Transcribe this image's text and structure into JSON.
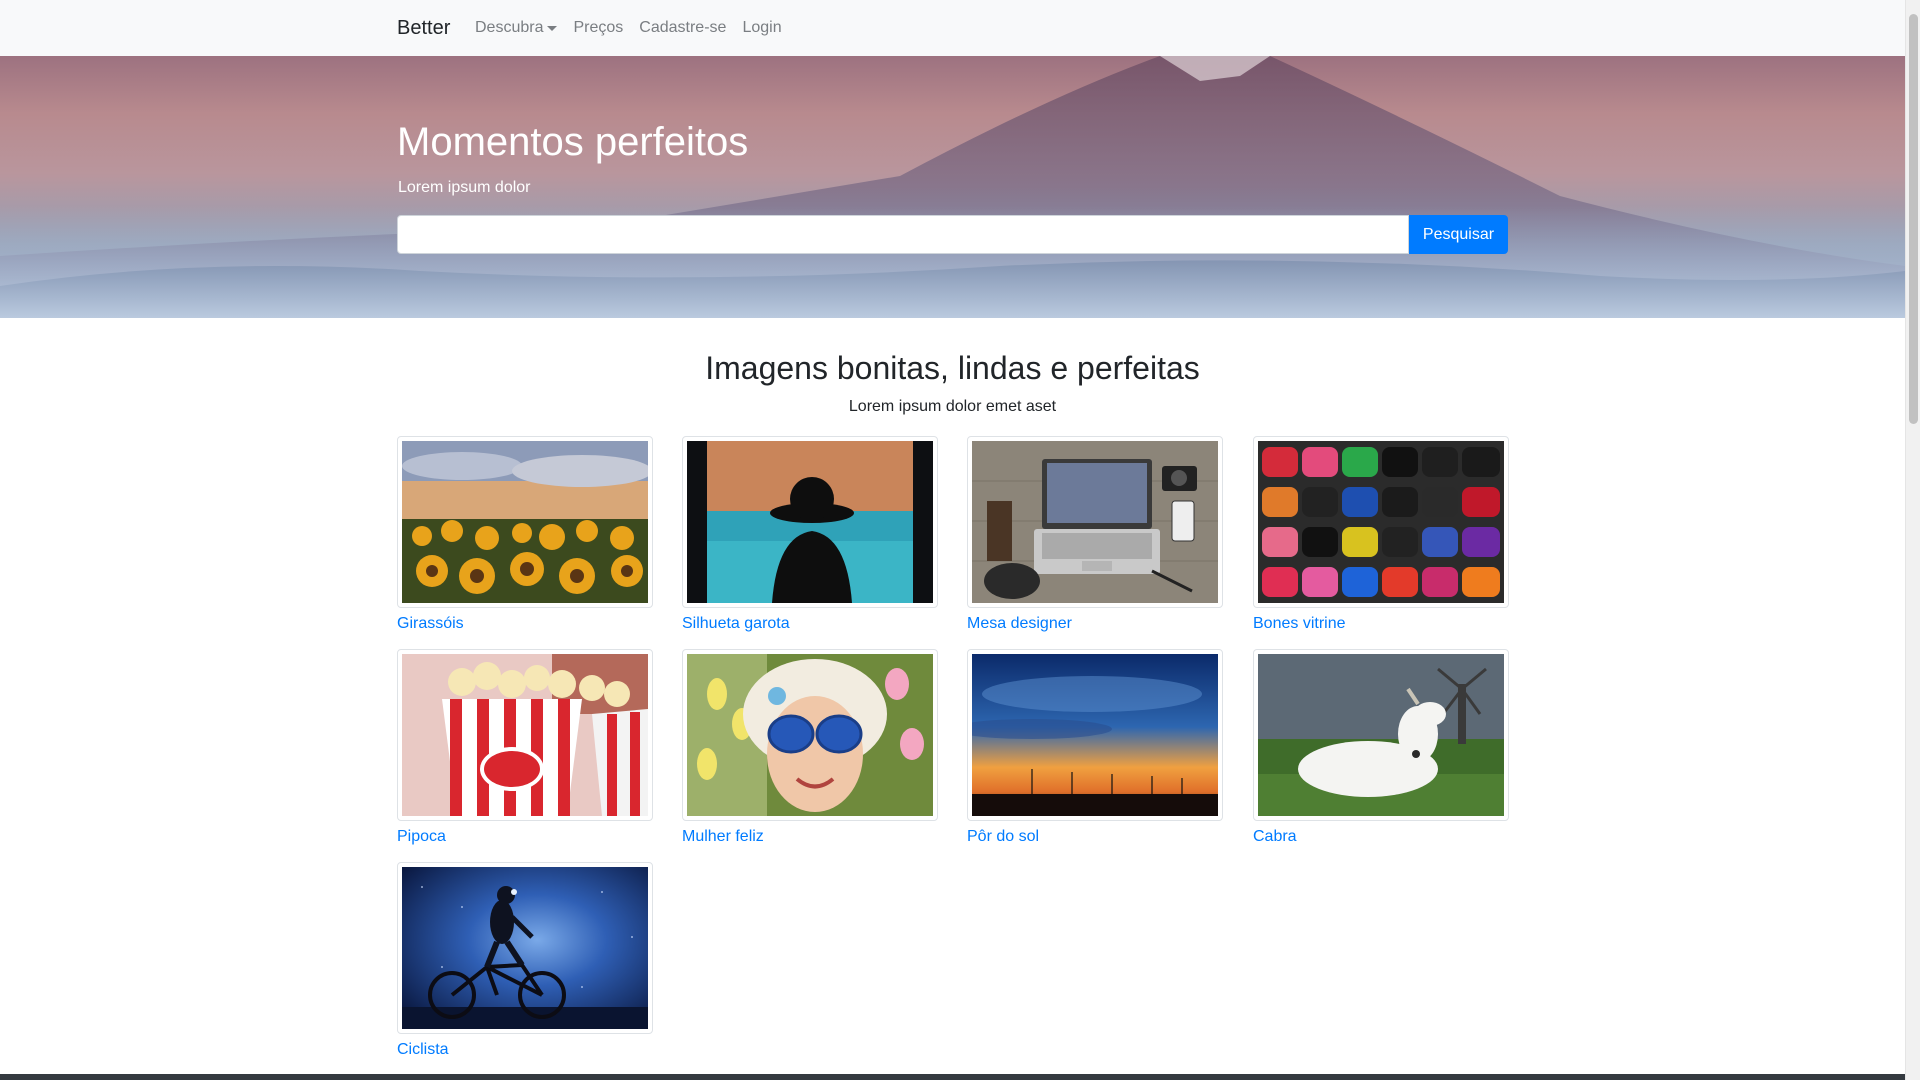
{
  "navbar": {
    "brand": "Better",
    "links": [
      {
        "label": "Descubra",
        "dropdown": true
      },
      {
        "label": "Preços"
      },
      {
        "label": "Cadastre-se"
      },
      {
        "label": "Login"
      }
    ]
  },
  "hero": {
    "title": "Momentos perfeitos",
    "subtitle": "Lorem ipsum dolor",
    "search": {
      "value": "",
      "placeholder": ""
    },
    "search_button": "Pesquisar"
  },
  "section": {
    "title": "Imagens bonitas, lindas e perfeitas",
    "subtitle": "Lorem ipsum dolor emet aset"
  },
  "gallery": [
    {
      "caption": "Girassóis",
      "image": "sunflowers"
    },
    {
      "caption": "Silhueta garota",
      "image": "silhouette"
    },
    {
      "caption": "Mesa designer",
      "image": "desk"
    },
    {
      "caption": "Bones vitrine",
      "image": "caps"
    },
    {
      "caption": "Pipoca",
      "image": "popcorn"
    },
    {
      "caption": "Mulher feliz",
      "image": "woman"
    },
    {
      "caption": "Pôr do sol",
      "image": "sunset"
    },
    {
      "caption": "Cabra",
      "image": "goat"
    },
    {
      "caption": "Ciclista",
      "image": "cyclist"
    }
  ],
  "colors": {
    "primary": "#007bff",
    "navbar_bg": "#f8f9fa",
    "text": "#212529",
    "muted": "#7a7e82"
  }
}
